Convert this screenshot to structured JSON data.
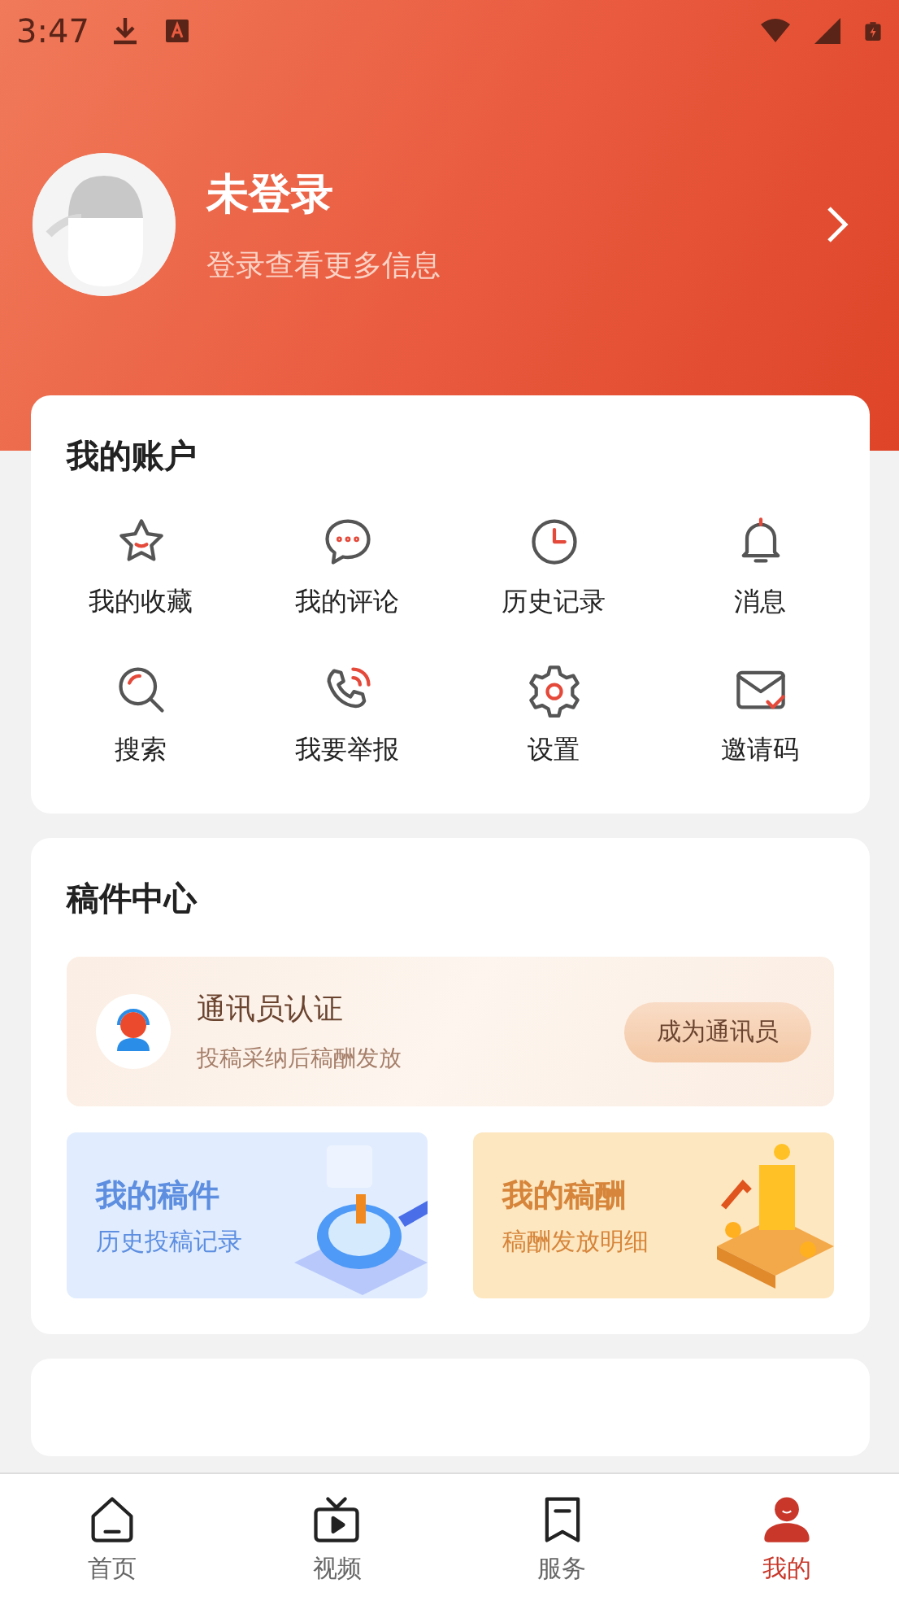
{
  "status_bar": {
    "time": "3:47"
  },
  "profile": {
    "name": "未登录",
    "subtitle": "登录查看更多信息"
  },
  "account": {
    "title": "我的账户",
    "items": [
      {
        "label": "我的收藏"
      },
      {
        "label": "我的评论"
      },
      {
        "label": "历史记录"
      },
      {
        "label": "消息"
      },
      {
        "label": "搜索"
      },
      {
        "label": "我要举报"
      },
      {
        "label": "设置"
      },
      {
        "label": "邀请码"
      }
    ]
  },
  "manuscripts": {
    "title": "稿件中心",
    "banner": {
      "title": "通讯员认证",
      "subtitle": "投稿采纳后稿酬发放",
      "button": "成为通讯员"
    },
    "tiles": [
      {
        "kind": "blue",
        "title": "我的稿件",
        "subtitle": "历史投稿记录"
      },
      {
        "kind": "gold",
        "title": "我的稿酬",
        "subtitle": "稿酬发放明细"
      }
    ]
  },
  "tab_bar": [
    {
      "label": "首页",
      "selected": false
    },
    {
      "label": "视频",
      "selected": false
    },
    {
      "label": "服务",
      "selected": false
    },
    {
      "label": "我的",
      "selected": true
    }
  ]
}
